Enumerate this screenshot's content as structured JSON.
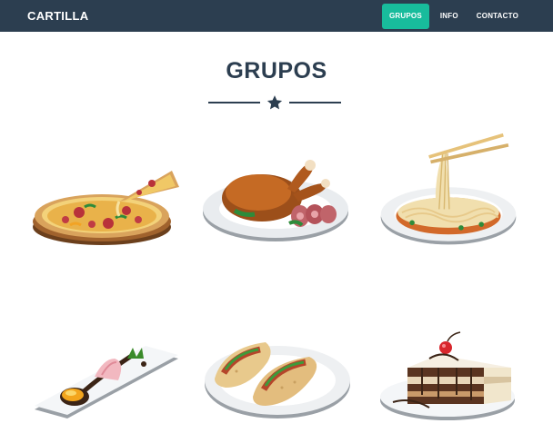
{
  "navbar": {
    "brand": "CARTILLA",
    "items": [
      {
        "label": "GRUPOS",
        "active": true
      },
      {
        "label": "INFO",
        "active": false
      },
      {
        "label": "CONTACTO",
        "active": false
      }
    ]
  },
  "section": {
    "title": "GRUPOS",
    "divider_icon": "star-icon"
  },
  "colors": {
    "navbar_bg": "#2c3e50",
    "accent": "#18bc9c",
    "text": "#2c3e50"
  },
  "portfolio": [
    {
      "icon": "pizza-icon"
    },
    {
      "icon": "roast-chicken-icon"
    },
    {
      "icon": "spaghetti-icon"
    },
    {
      "icon": "egg-dessert-icon"
    },
    {
      "icon": "tacos-icon"
    },
    {
      "icon": "cake-slice-icon"
    }
  ]
}
